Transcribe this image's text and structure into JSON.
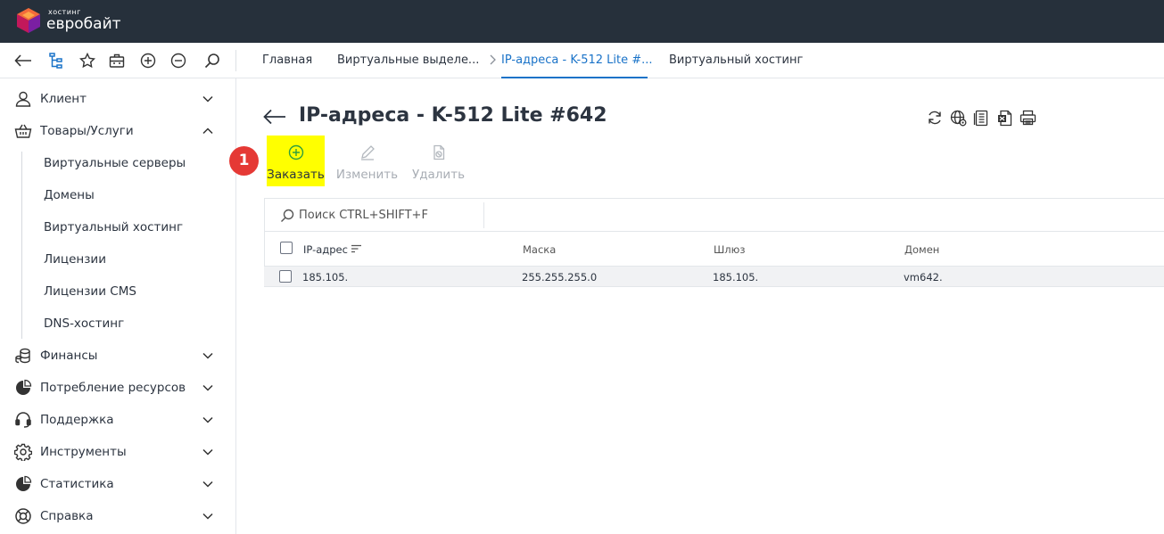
{
  "topbar": {
    "logo_small": "хостинг",
    "logo_big": "евробайт"
  },
  "tabs": [
    {
      "label": "Главная"
    },
    {
      "label": "Виртуальные выделе..."
    },
    {
      "label": "IP-адреса - K-512 Lite #..."
    },
    {
      "label": "Виртуальный хостинг"
    }
  ],
  "sidebar": {
    "items": [
      {
        "label": "Клиент",
        "icon": "user-icon",
        "expanded": false
      },
      {
        "label": "Товары/Услуги",
        "icon": "basket-icon",
        "expanded": true
      },
      {
        "label": "Финансы",
        "icon": "coins-icon",
        "expanded": false
      },
      {
        "label": "Потребление ресурсов",
        "icon": "pie-chart-icon",
        "expanded": false
      },
      {
        "label": "Поддержка",
        "icon": "headset-icon",
        "expanded": false
      },
      {
        "label": "Инструменты",
        "icon": "gear-icon",
        "expanded": false
      },
      {
        "label": "Статистика",
        "icon": "stats-icon",
        "expanded": false
      },
      {
        "label": "Справка",
        "icon": "lifebuoy-icon",
        "expanded": false
      }
    ],
    "subitems": [
      {
        "label": "Виртуальные серверы"
      },
      {
        "label": "Домены"
      },
      {
        "label": "Виртуальный хостинг"
      },
      {
        "label": "Лицензии"
      },
      {
        "label": "Лицензии CMS"
      },
      {
        "label": "DNS-хостинг"
      }
    ]
  },
  "page": {
    "title": "IP-адреса - K-512 Lite #642"
  },
  "actions": {
    "order": "Заказать",
    "edit": "Изменить",
    "delete": "Удалить"
  },
  "badge": "1",
  "search": {
    "placeholder": "Поиск CTRL+SHIFT+F"
  },
  "table": {
    "columns": [
      "IP-адрес",
      "Маска",
      "Шлюз",
      "Домен"
    ],
    "rows": [
      {
        "ip": "185.105.",
        "mask": "255.255.255.0",
        "gateway": "185.105.",
        "domain": "vm642."
      }
    ]
  },
  "colors": {
    "topbar": "#26303b",
    "accent": "#1a73c8",
    "highlight": "#ffff00",
    "badge": "#e53935",
    "order_icon": "#2e9e3f"
  }
}
